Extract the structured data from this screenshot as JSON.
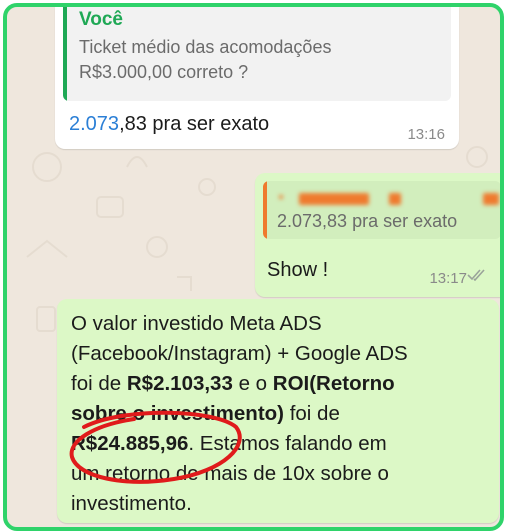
{
  "incoming": {
    "quote_author": "Você",
    "quote_line1": "Ticket médio das acomodações",
    "quote_line2": "R$3.000,00 correto ?",
    "message_number": "2.073",
    "message_rest": ",83 pra ser exato",
    "time": "13:16"
  },
  "outgoing": {
    "quote_text": "2.073,83 pra ser exato",
    "message": "Show !",
    "time": "13:17"
  },
  "note": {
    "l1": "O valor investido Meta ADS",
    "l2": "(Facebook/Instagram) + Google ADS",
    "l3_a": "foi de ",
    "l3_b": "R$2.103,33",
    "l3_c": " e o ",
    "l3_d": "ROI(Retorno",
    "l4_a": "sobre o investimento)",
    "l4_b": " foi de",
    "l5_a": "R$24.885,96",
    "l5_b": ". Estamos falando em",
    "l6": "um retorno de mais de 10x sobre o",
    "l7": "investimento."
  },
  "colors": {
    "frame": "#2fd36a",
    "incoming_bubble": "#ffffff",
    "outgoing_bubble": "#dcf8c6",
    "quote_author": "#1fa855",
    "highlight_circle": "#e01b1b",
    "link_number": "#2b7fd6"
  }
}
